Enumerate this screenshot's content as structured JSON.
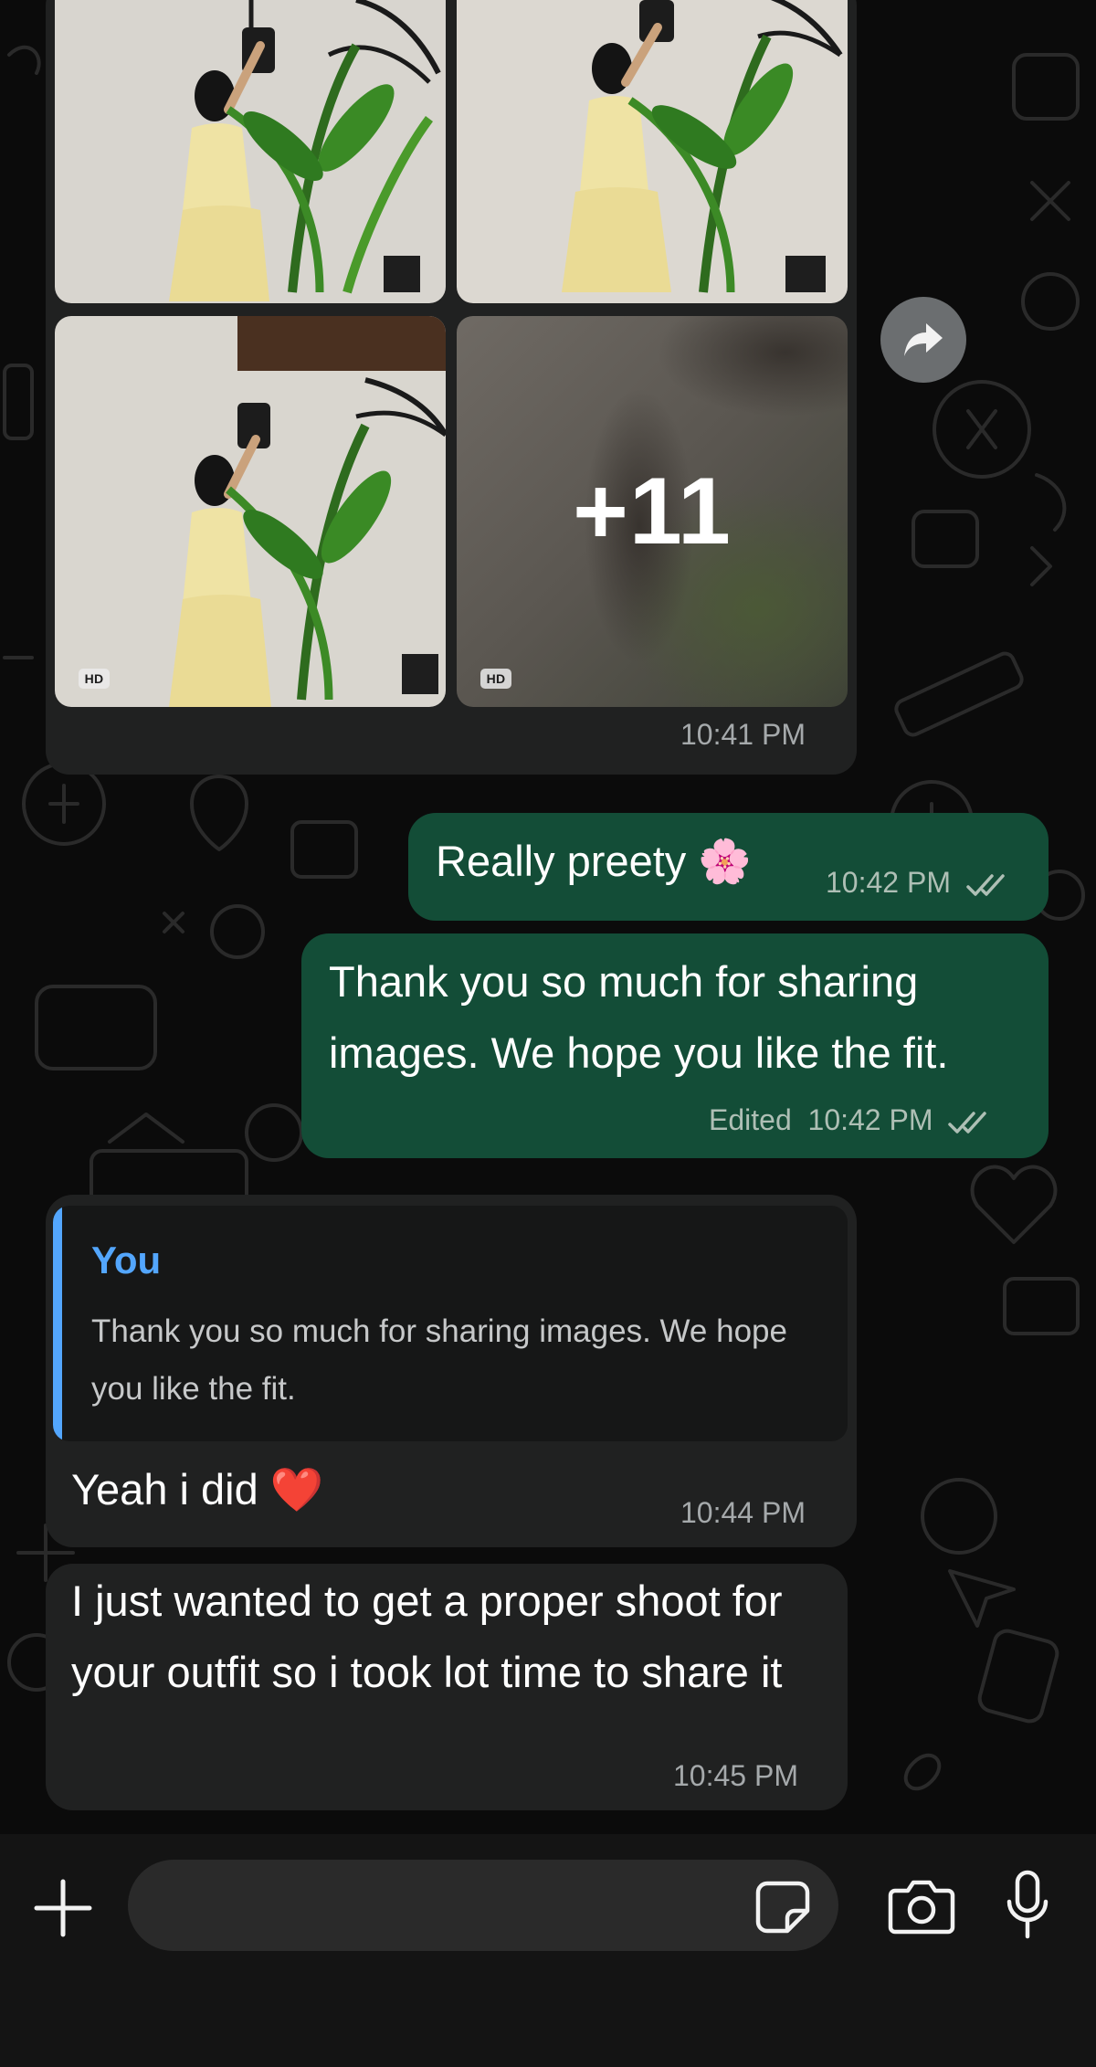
{
  "chat": {
    "image_group": {
      "more_count": "+11",
      "hd_label": "HD",
      "time": "10:41 PM"
    },
    "messages": [
      {
        "direction": "outgoing",
        "text": "Really preety 🌸",
        "time": "10:42 PM",
        "status_icon": "double-check-icon"
      },
      {
        "direction": "outgoing",
        "text": "Thank you so much for sharing images. We hope you like the fit.",
        "edited_label": "Edited",
        "time": "10:42 PM",
        "status_icon": "double-check-icon"
      },
      {
        "direction": "incoming",
        "reply_to": {
          "author": "You",
          "text": "Thank you so much for sharing images. We hope you like the fit."
        },
        "text": "Yeah i did ❤️",
        "time": "10:44 PM"
      },
      {
        "direction": "incoming",
        "text": "I just wanted to get a proper shoot for your outfit so i took lot time to share it",
        "time": "10:45 PM"
      }
    ]
  },
  "composer": {
    "input_value": "",
    "icons": [
      "plus-icon",
      "sticker-icon",
      "camera-icon",
      "microphone-icon"
    ]
  },
  "colors": {
    "background": "#0b0b0b",
    "incoming_bubble": "#202121",
    "outgoing_bubble": "#134d37",
    "quote_accent": "#53a6fd",
    "timestamp": "#a5a9ab"
  }
}
